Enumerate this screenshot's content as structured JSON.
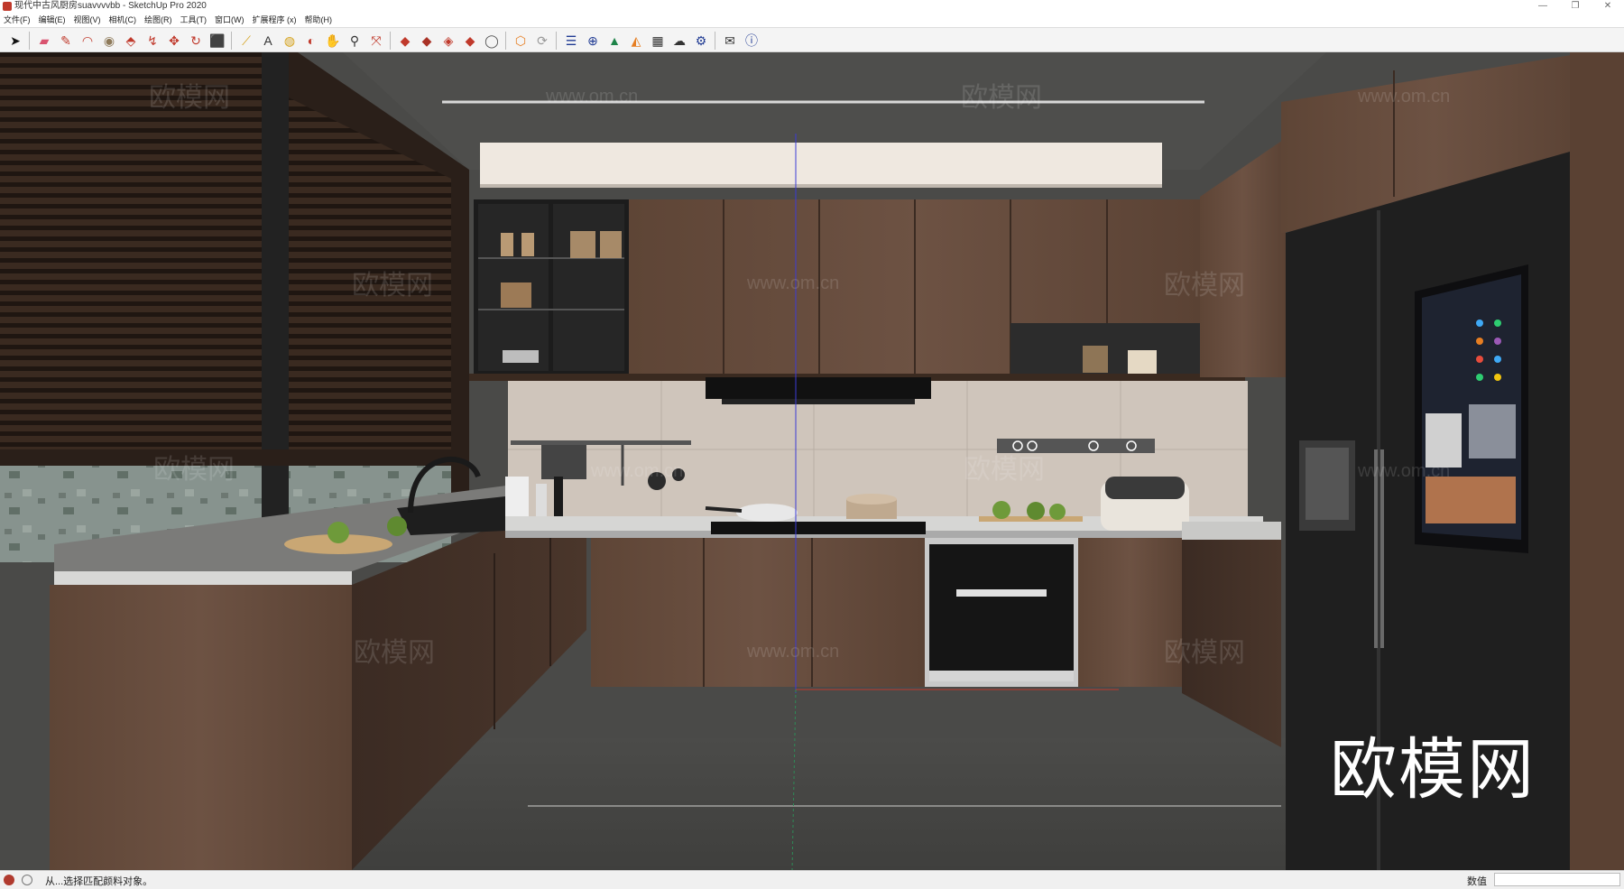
{
  "window": {
    "title": "现代中古风厨房suavvvvbb - SketchUp Pro 2020",
    "controls": [
      "—",
      "❐",
      "✕"
    ]
  },
  "menu": [
    "文件(F)",
    "编辑(E)",
    "视图(V)",
    "相机(C)",
    "绘图(R)",
    "工具(T)",
    "窗口(W)",
    "扩展程序 (x)",
    "帮助(H)"
  ],
  "toolbar": {
    "tools": [
      {
        "name": "select-tool-icon",
        "glyph": "➤",
        "color": "#111111"
      },
      {
        "name": "eraser-tool-icon",
        "glyph": "▰",
        "color": "#d9536f"
      },
      {
        "name": "line-tool-icon",
        "glyph": "✎",
        "color": "#c0392b"
      },
      {
        "name": "arc-tool-icon",
        "glyph": "◠",
        "color": "#c0392b"
      },
      {
        "name": "shape-tool-icon",
        "glyph": "◉",
        "color": "#8e7a5a"
      },
      {
        "name": "push-pull-tool-icon",
        "glyph": "⬘",
        "color": "#c0392b"
      },
      {
        "name": "follow-me-tool-icon",
        "glyph": "↯",
        "color": "#c0392b"
      },
      {
        "name": "move-tool-icon",
        "glyph": "✥",
        "color": "#c0392b"
      },
      {
        "name": "rotate-tool-icon",
        "glyph": "↻",
        "color": "#c0392b"
      },
      {
        "name": "scale-tool-icon",
        "glyph": "⬛",
        "color": "#c0392b"
      },
      {
        "name": "tape-measure-tool-icon",
        "glyph": "⟋",
        "color": "#d4a017"
      },
      {
        "name": "text-tool-icon",
        "glyph": "A",
        "color": "#333333"
      },
      {
        "name": "paint-bucket-tool-icon",
        "glyph": "◍",
        "color": "#d4a017"
      },
      {
        "name": "orbit-tool-icon",
        "glyph": "◐",
        "color": "#c0392b"
      },
      {
        "name": "pan-tool-icon",
        "glyph": "✋",
        "color": "#d4a017"
      },
      {
        "name": "zoom-tool-icon",
        "glyph": "⚲",
        "color": "#333333"
      },
      {
        "name": "zoom-extents-tool-icon",
        "glyph": "⤧",
        "color": "#c0392b"
      },
      {
        "name": "warehouse-icon",
        "glyph": "◆",
        "color": "#c0392b"
      },
      {
        "name": "components-icon",
        "glyph": "◆",
        "color": "#a93226"
      },
      {
        "name": "materials-icon",
        "glyph": "◈",
        "color": "#c0392b"
      },
      {
        "name": "extension-warehouse-icon",
        "glyph": "◆",
        "color": "#c0392b"
      },
      {
        "name": "account-icon",
        "glyph": "◯",
        "color": "#555555"
      },
      {
        "name": "layout-icon",
        "glyph": "⬡",
        "color": "#e67e22"
      },
      {
        "name": "sync-icon",
        "glyph": "⟳",
        "color": "#999999"
      },
      {
        "name": "layers-icon",
        "glyph": "☰",
        "color": "#1f3a93"
      },
      {
        "name": "add-location-icon",
        "glyph": "⊕",
        "color": "#1f3a93"
      },
      {
        "name": "terrain-icon",
        "glyph": "▲",
        "color": "#1e8449"
      },
      {
        "name": "photo-texture-icon",
        "glyph": "◭",
        "color": "#e67e22"
      },
      {
        "name": "grid-icon",
        "glyph": "▦",
        "color": "#333333"
      },
      {
        "name": "cloud-icon",
        "glyph": "☁",
        "color": "#333333"
      },
      {
        "name": "settings-icon",
        "glyph": "⚙",
        "color": "#1f3a93"
      },
      {
        "name": "mail-icon",
        "glyph": "✉",
        "color": "#333333"
      },
      {
        "name": "info-icon",
        "glyph": "ⓘ",
        "color": "#1f3a93"
      }
    ]
  },
  "scene": {
    "watermarks": [
      "www.om.cn",
      "欧模网"
    ],
    "brand_watermark": "欧模网"
  },
  "status": {
    "message": "从...选择匹配颜料对象。",
    "vcb_label": "数值",
    "vcb_value": ""
  }
}
